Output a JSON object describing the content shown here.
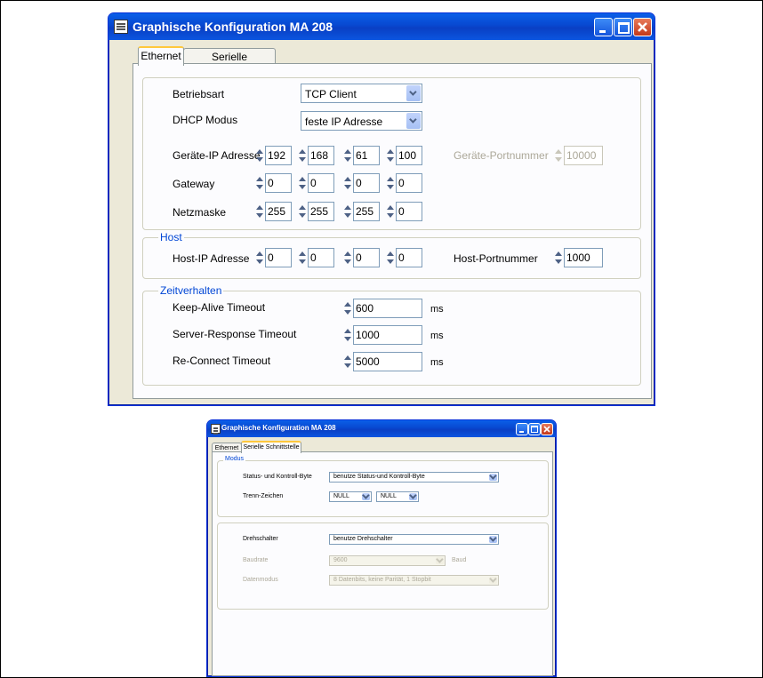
{
  "window1": {
    "title": "Graphische Konfiguration MA 208",
    "tabs": [
      "Ethernet",
      "Serielle Schnittstelle"
    ],
    "betriebsart": {
      "label": "Betriebsart",
      "value": "TCP Client"
    },
    "dhcp": {
      "label": "DHCP Modus",
      "value": "feste IP Adresse"
    },
    "geraete_ip": {
      "label": "Geräte-IP Adresse",
      "octets": [
        "192",
        "168",
        "61",
        "100"
      ]
    },
    "geraete_port": {
      "label": "Geräte-Portnummer",
      "value": "10000"
    },
    "gateway": {
      "label": "Gateway",
      "octets": [
        "0",
        "0",
        "0",
        "0"
      ]
    },
    "netzmaske": {
      "label": "Netzmaske",
      "octets": [
        "255",
        "255",
        "255",
        "0"
      ]
    },
    "host": {
      "legend": "Host",
      "ip_label": "Host-IP Adresse",
      "octets": [
        "0",
        "0",
        "0",
        "0"
      ],
      "port_label": "Host-Portnummer",
      "port_value": "1000"
    },
    "zeit": {
      "legend": "Zeitverhalten",
      "rows": [
        {
          "label": "Keep-Alive Timeout",
          "value": "600",
          "unit": "ms"
        },
        {
          "label": "Server-Response Timeout",
          "value": "1000",
          "unit": "ms"
        },
        {
          "label": "Re-Connect Timeout",
          "value": "5000",
          "unit": "ms"
        }
      ]
    }
  },
  "window2": {
    "title": "Graphische Konfiguration MA 208",
    "tabs": [
      "Ethernet",
      "Serielle Schnittstelle"
    ],
    "modus": {
      "legend": "Modus",
      "status_label": "Status- und Kontroll-Byte",
      "status_value": "benutze Status-und Kontroll-Byte",
      "trenn_label": "Trenn-Zeichen",
      "trenn_values": [
        "NULL",
        "NULL"
      ]
    },
    "dreh": {
      "label": "Drehschalter",
      "value": "benutze Drehschalter",
      "baud_label": "Baudrate",
      "baud_value": "9600",
      "baud_unit": "Baud",
      "daten_label": "Datenmodus",
      "daten_value": "8 Datenbits, keine    Parität, 1 Stopbit"
    }
  },
  "icons": {
    "window": "window-icon",
    "minimize": "minimize-icon",
    "maximize": "maximize-icon",
    "close": "close-icon"
  }
}
